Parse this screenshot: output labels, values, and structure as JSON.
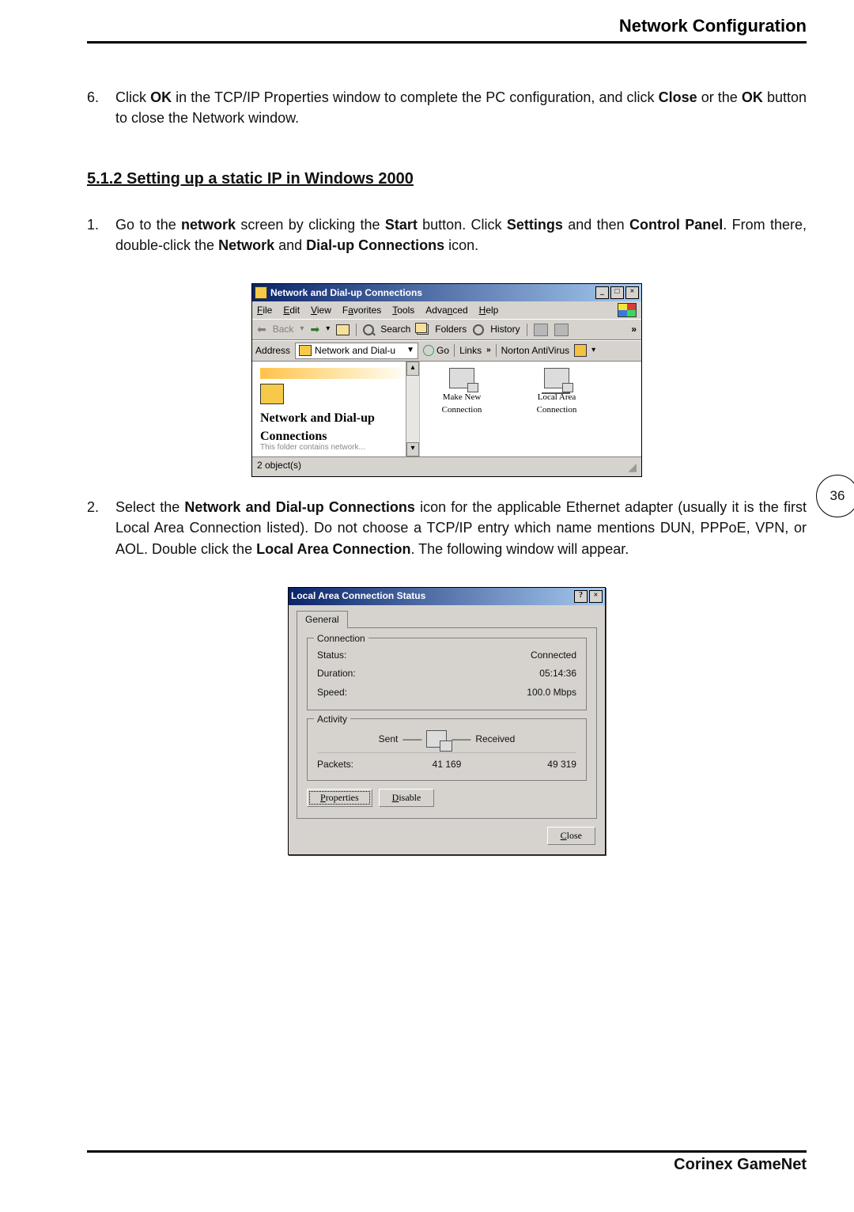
{
  "header": {
    "title": "Network Configuration"
  },
  "step6": {
    "num": "6.",
    "t1": "Click ",
    "ok": "OK",
    "t2": " in the TCP/IP Properties window to complete the PC configuration, and click ",
    "close": "Close",
    "t3": " or the ",
    "ok2": "OK",
    "t4": " button to close the Network window."
  },
  "section_heading": "5.1.2 Setting up a static IP in Windows 2000",
  "step1": {
    "num": "1.",
    "t1": "Go to the ",
    "network": "network",
    "t2": " screen by clicking the ",
    "start": "Start",
    "t3": " button. Click ",
    "settings": "Settings",
    "t4": " and then ",
    "cp": "Control Panel",
    "t5": ". From there, double-click the ",
    "netand": "Network",
    "t6": " and ",
    "dial": "Dial-up Connections",
    "t7": " icon."
  },
  "win1": {
    "title": "Network and Dial-up Connections",
    "minimize": "_",
    "maximize": "□",
    "close": "×",
    "menu": {
      "file": "File",
      "edit": "Edit",
      "view": "View",
      "favorites": "Favorites",
      "tools": "Tools",
      "advanced": "Advanced",
      "help": "Help"
    },
    "toolbar1": {
      "back": "Back",
      "search": "Search",
      "folders": "Folders",
      "history": "History",
      "chevrons": "»"
    },
    "toolbar2": {
      "address": "Address",
      "address_value": "Network and Dial-u",
      "go": "Go",
      "links": "Links",
      "links_chev": "»",
      "norton": "Norton AntiVirus"
    },
    "left": {
      "title": "Network and Dial-up Connections",
      "tiny": "This folder contains network..."
    },
    "icons": {
      "make_new": "Make New Connection",
      "local": "Local Area Connection"
    },
    "status": "2 object(s)"
  },
  "step2": {
    "num": "2.",
    "t1": "Select the ",
    "b1": "Network and Dial-up Connections",
    "t2": " icon for the applicable Ethernet adapter (usually it is the first Local Area Connection listed). Do not choose a TCP/IP entry which name mentions DUN, PPPoE, VPN, or AOL. Double click the ",
    "b2": "Local Area Connection",
    "t3": ". The following window will appear."
  },
  "win2": {
    "title": "Local Area Connection Status",
    "help": "?",
    "close": "×",
    "tab": "General",
    "connection": {
      "legend": "Connection",
      "status_label": "Status:",
      "status_value": "Connected",
      "duration_label": "Duration:",
      "duration_value": "05:14:36",
      "speed_label": "Speed:",
      "speed_value": "100.0 Mbps"
    },
    "activity": {
      "legend": "Activity",
      "sent": "Sent",
      "received": "Received",
      "dash": "——",
      "packets_label": "Packets:",
      "sent_value": "41 169",
      "received_value": "49 319"
    },
    "buttons": {
      "properties": "Properties",
      "disable": "Disable",
      "close_btn": "Close"
    }
  },
  "page_number": "36",
  "footer": "Corinex GameNet"
}
